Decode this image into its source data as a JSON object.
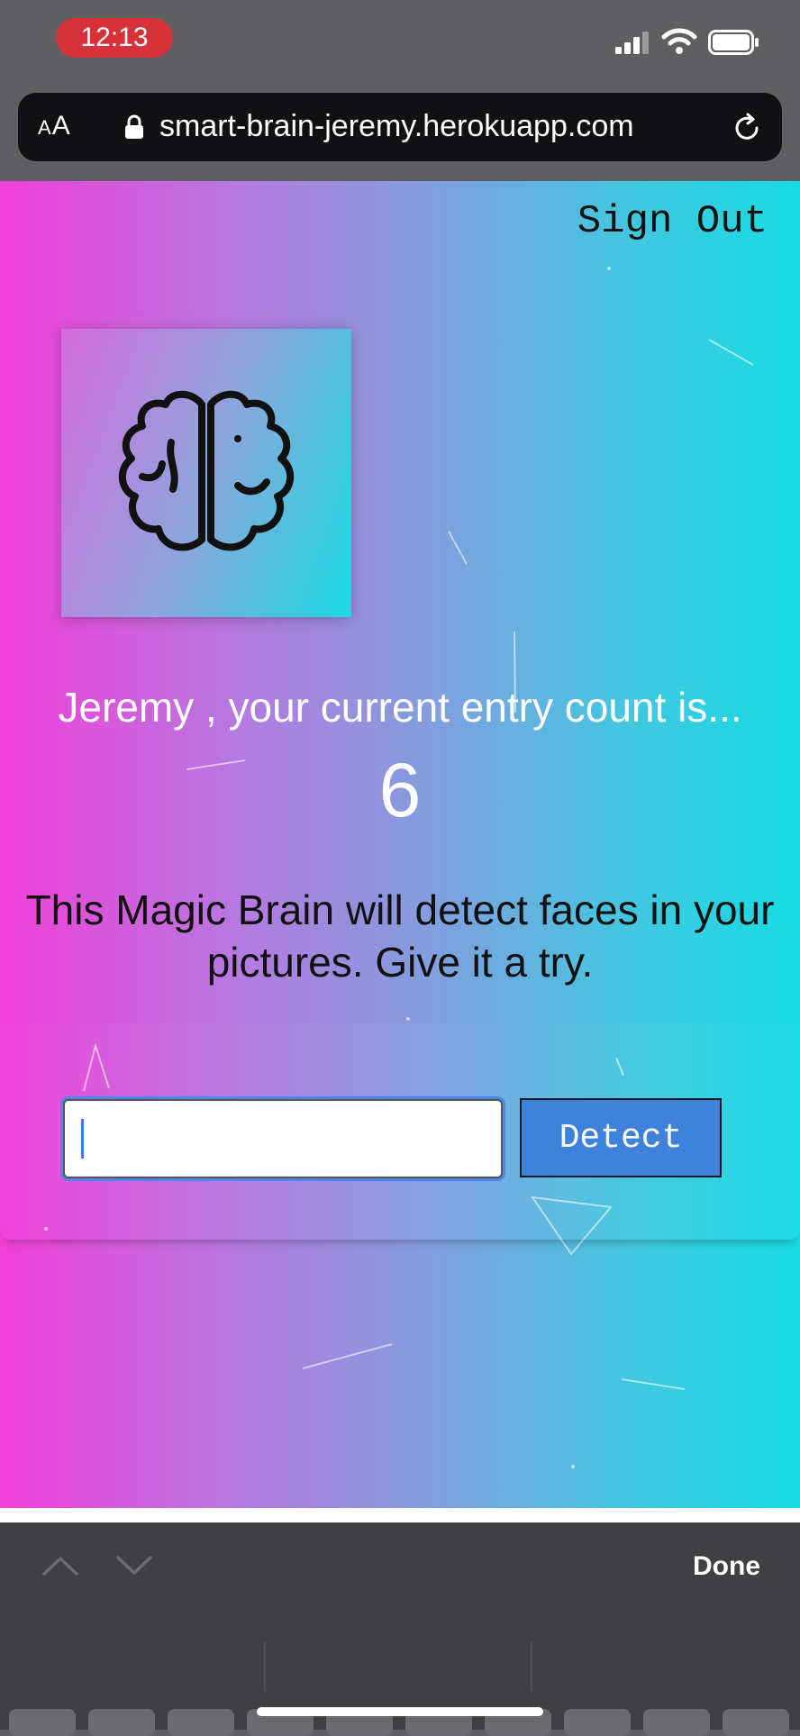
{
  "status_bar": {
    "time": "12:13"
  },
  "browser": {
    "text_size_label_small": "A",
    "text_size_label_large": "A",
    "url": "smart-brain-jeremy.herokuapp.com"
  },
  "page": {
    "sign_out_label": "Sign Out",
    "entry_count_text": "Jeremy , your current entry count is...",
    "entry_count": "6",
    "description": "This Magic Brain will detect faces in your pictures. Give it a try.",
    "image_url_input": {
      "value": "",
      "placeholder": ""
    },
    "detect_button_label": "Detect"
  },
  "keyboard_toolbar": {
    "done_label": "Done"
  },
  "colors": {
    "gradient_left": "#f23fd8",
    "gradient_right": "#17dbe2",
    "detect_button": "#3e82dc",
    "time_pill": "#d7323a"
  }
}
